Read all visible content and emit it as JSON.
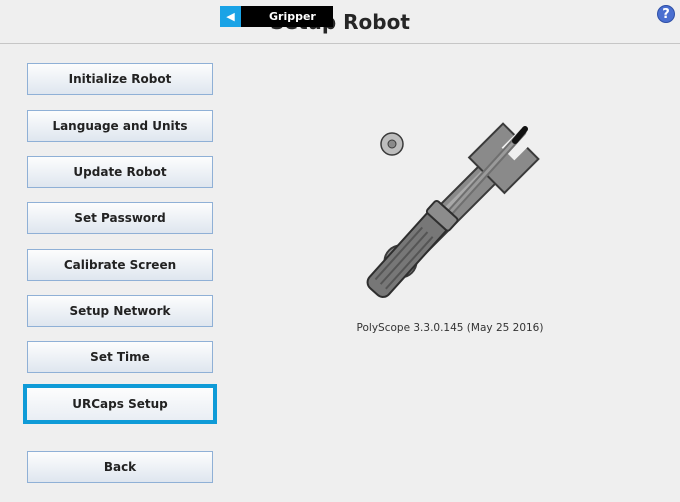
{
  "header": {
    "title": "Setup Robot",
    "gripper_tab": {
      "label": "Gripper",
      "icon": "caret-left-icon"
    },
    "help_label": "?"
  },
  "menu": {
    "items": [
      {
        "label": "Initialize Robot"
      },
      {
        "label": "Language and Units"
      },
      {
        "label": "Update Robot"
      },
      {
        "label": "Set Password"
      },
      {
        "label": "Calibrate Screen"
      },
      {
        "label": "Setup Network"
      },
      {
        "label": "Set Time"
      },
      {
        "label": "URCaps Setup",
        "selected": true
      }
    ],
    "back_label": "Back"
  },
  "main": {
    "illustration": "wrench-screwdriver-icon",
    "version": "PolyScope 3.3.0.145 (May 25 2016)"
  },
  "colors": {
    "selected_border": "#0f9bd7",
    "button_border": "#8fb0d6",
    "gripper_accent": "#1aa3e6"
  }
}
